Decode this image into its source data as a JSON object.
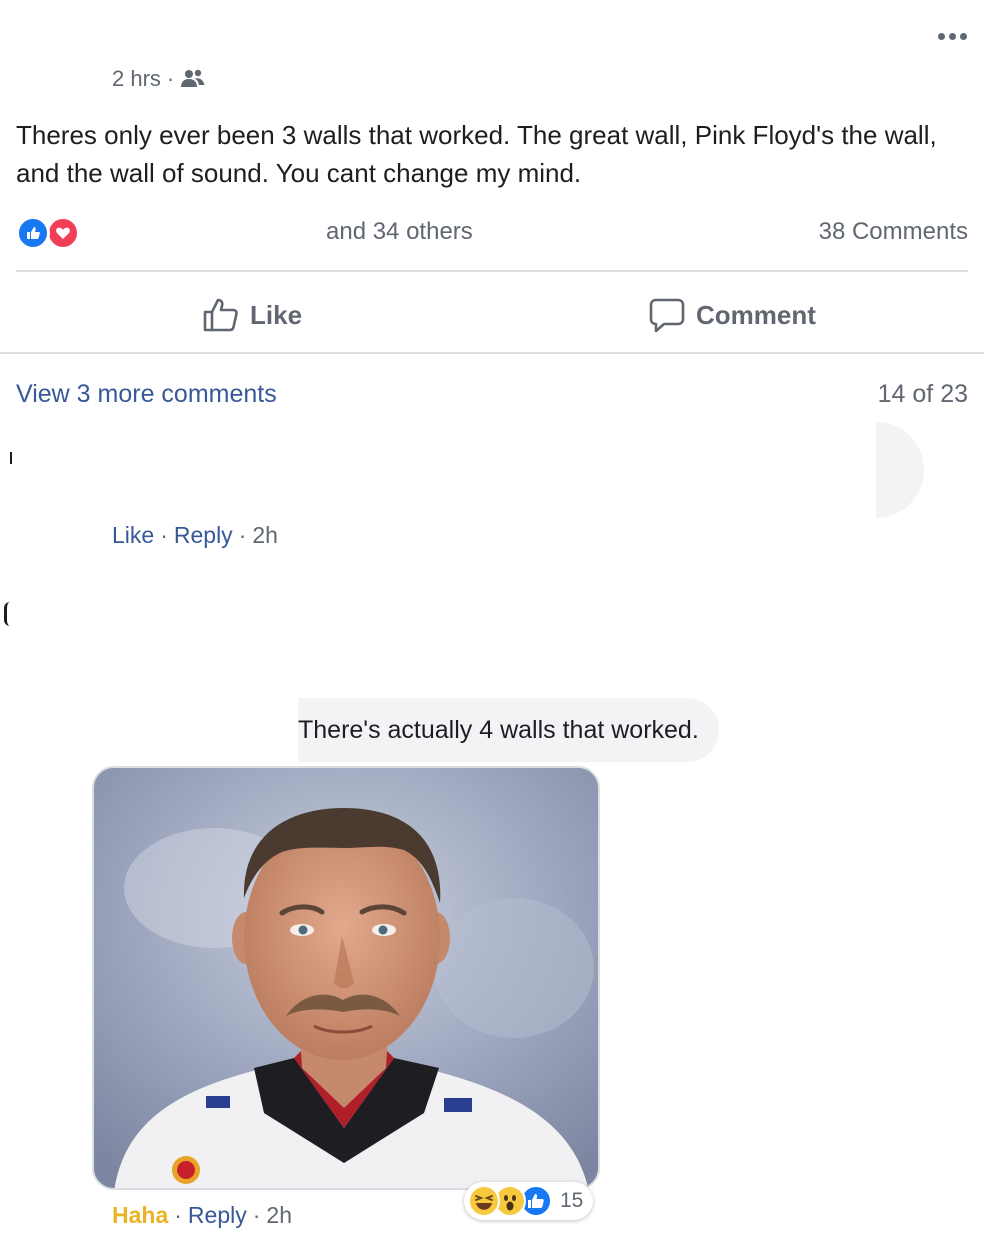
{
  "post": {
    "timestamp": "2 hrs",
    "separator": "·",
    "audience_icon": "friends-icon",
    "text": "Theres only ever been 3 walls that worked. The great wall, Pink Floyd's the wall, and the wall of sound. You cant change my mind.",
    "reactions": [
      "like-icon",
      "love-icon"
    ],
    "others_text": "and 34 others",
    "comments_count_text": "38 Comments"
  },
  "actions": {
    "like_label": "Like",
    "comment_label": "Comment"
  },
  "comments": {
    "view_more": "View 3 more comments",
    "position": "14 of 23",
    "first": {
      "like": "Like",
      "sep": "·",
      "reply": "Reply",
      "time": "2h"
    },
    "reply": {
      "text": "There's actually 4 walls that worked.",
      "reaction_label": "Haha",
      "sep": "·",
      "reply": "Reply",
      "time": "2h",
      "reaction_icons": [
        "haha-icon",
        "wow-icon",
        "like-icon"
      ],
      "reaction_count": "15"
    }
  },
  "colors": {
    "link": "#385898",
    "meta": "#606770",
    "like_blue": "#1877f2",
    "love_red": "#f33e58",
    "haha_yellow": "#e9b426",
    "bubble": "#f2f3f5"
  }
}
